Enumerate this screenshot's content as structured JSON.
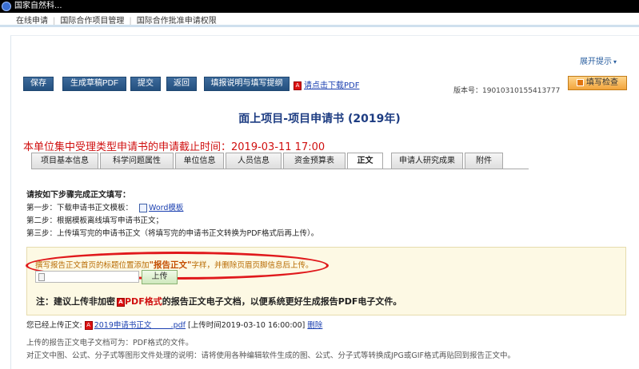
{
  "window": {
    "title": "国家自然科..."
  },
  "topnav": {
    "items": [
      "在线申请",
      "国际合作项目管理",
      "国际合作批准申请权限"
    ]
  },
  "expand": {
    "label": "展开提示"
  },
  "toolbar": {
    "save": "保存",
    "gen_pdf": "生成草稿PDF",
    "submit": "提交",
    "back": "返回",
    "fill_help": "填报说明与填写提纲",
    "download_link": "请点击下载PDF"
  },
  "version": {
    "label": "版本号：19010310155413777"
  },
  "check_button": {
    "label": "填写检查"
  },
  "page_title": "面上项目-项目申请书 (2019年)",
  "deadline": "本单位集中受理类型申请书的申请截止时间：2019-03-11 17:00",
  "tabs": [
    "项目基本信息",
    "科学问题属性",
    "单位信息",
    "人员信息",
    "资金预算表",
    "正文",
    "申请人研究成果",
    "附件"
  ],
  "active_tab": "正文",
  "steps": {
    "title": "请按如下步骤完成正文填写：",
    "step1": "第一步：下载申请书正文模板：",
    "step1_link": "Word模板",
    "step2": "第二步：根据模板离线填写申请书正文；",
    "step3": "第三步：上传填写完的申请书正文（将填写完的申请书正文转换为PDF格式后再上传）。"
  },
  "upload": {
    "notice_pre": "撰写报告正文首页的标题位置添加",
    "notice_highlight": "\"报告正文\"",
    "notice_post": "字样，并删除页眉页脚信息后上传。",
    "button": "上传",
    "note_pre": "注：建议上传非加密",
    "note_red": "PDF格式",
    "note_post": "的报告正文电子文档，以便系统更好生成报告PDF电子文件。"
  },
  "uploaded": {
    "label": "您已经上传正文:",
    "file_link": "2019申请书正文",
    "file_ext": "pdf",
    "upload_time": "[上传时间2019-03-10 16:00:00]",
    "delete": "删除"
  },
  "format_note": "上传的报告正文电子文档可为：PDF格式的文件。",
  "convert_note": "对正文中图、公式、分子式等图形文件处理的说明：请将使用各种编辑软件生成的图、公式、分子式等转换成JPG或GIF格式再贴回到报告正文中。"
}
